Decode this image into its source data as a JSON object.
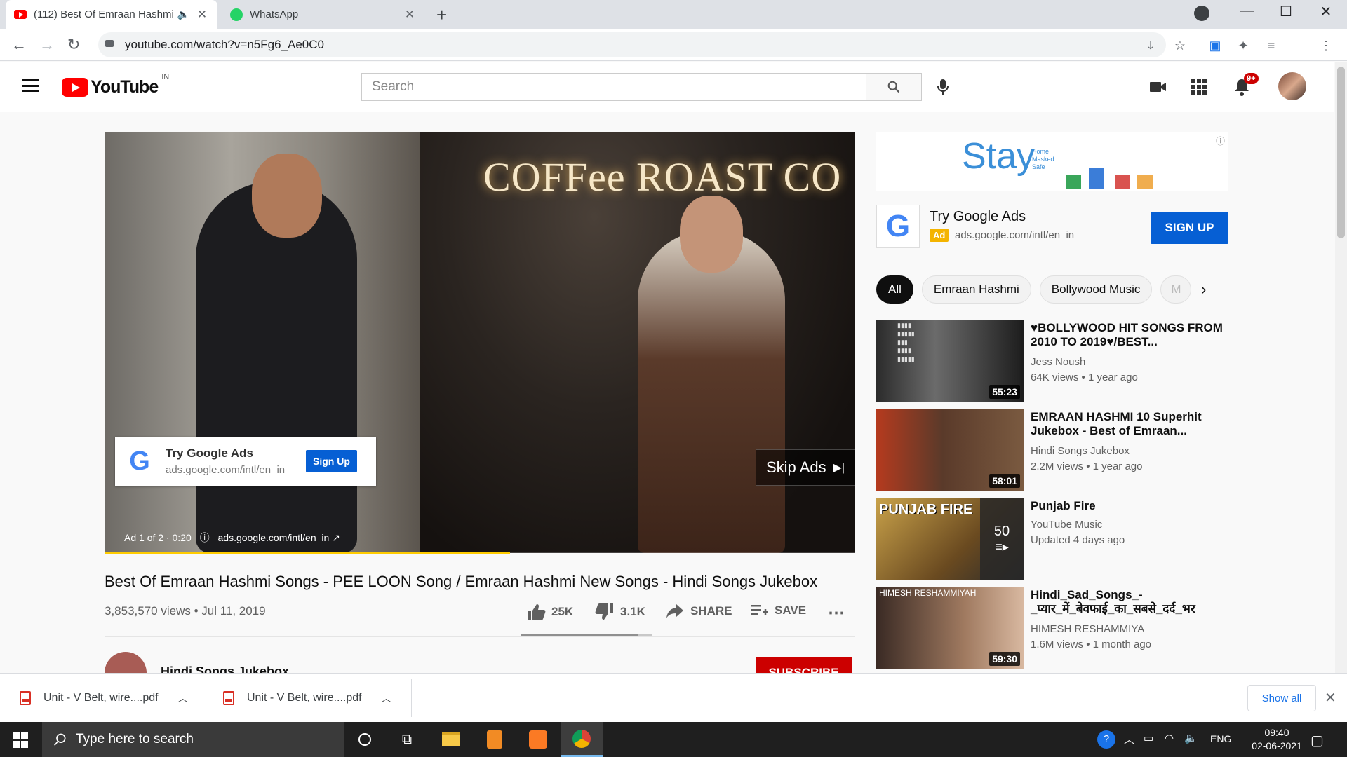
{
  "browser": {
    "tabs": [
      {
        "title": "(112) Best Of Emraan Hashmi",
        "favicon": "youtube-icon",
        "audio": true
      },
      {
        "title": "WhatsApp",
        "favicon": "whatsapp-icon"
      }
    ],
    "url": "youtube.com/watch?v=n5Fg6_Ae0C0"
  },
  "youtube": {
    "logo_text": "YouTube",
    "country_code": "IN",
    "search_placeholder": "Search",
    "notification_count": "9+"
  },
  "player": {
    "ad_overlay": {
      "title": "Try Google Ads",
      "url": "ads.google.com/intl/en_in",
      "button": "Sign Up"
    },
    "skip_label": "Skip Ads",
    "ad_info": "Ad 1 of 2 · 0:20",
    "ad_info_url": "ads.google.com/intl/en_in",
    "scene_sign": "COFFee ROAST CO",
    "ad_progress": 0.54
  },
  "video": {
    "title": "Best Of Emraan Hashmi Songs - PEE LOON Song / Emraan Hashmi New Songs - Hindi Songs Jukebox",
    "stats": "3,853,570 views • Jul 11, 2019",
    "likes": "25K",
    "dislikes": "3.1K",
    "share_label": "SHARE",
    "save_label": "SAVE",
    "like_ratio": 0.89,
    "channel_name": "Hindi Songs Jukebox",
    "subscribe_label": "SUBSCRIBE"
  },
  "sidebar": {
    "banner_text": "Stay",
    "banner_sub": [
      "Home",
      "Masked",
      "Safe"
    ],
    "promo": {
      "title": "Try Google Ads",
      "badge": "Ad",
      "url": "ads.google.com/intl/en_in",
      "button": "SIGN UP"
    },
    "chips": [
      "All",
      "Emraan Hashmi",
      "Bollywood Music",
      "M"
    ],
    "recommendations": [
      {
        "title": "♥BOLLYWOOD HIT SONGS FROM 2010 TO 2019♥/BEST...",
        "channel": "Jess Noush",
        "meta": "64K views • 1 year ago",
        "duration": "55:23"
      },
      {
        "title": "EMRAAN HASHMI 10 Superhit Jukebox - Best of Emraan...",
        "channel": "Hindi Songs Jukebox",
        "meta": "2.2M views • 1 year ago",
        "duration": "58:01"
      },
      {
        "title": "Punjab Fire",
        "channel": "YouTube Music",
        "meta": "Updated 4 days ago",
        "playlist_count": "50",
        "thumb_text": "PUNJAB FIRE"
      },
      {
        "title": "Hindi_Sad_Songs_-_प्यार_में_बेवफाई_का_सबसे_दर्द_भर",
        "channel": "HIMESH RESHAMMIYA",
        "meta": "1.6M views • 1 month ago",
        "duration": "59:30",
        "thumb_text": "HIMESH RESHAMMIYAH"
      }
    ]
  },
  "downloads": {
    "items": [
      "Unit - V Belt,  wire....pdf",
      "Unit - V Belt,  wire....pdf"
    ],
    "show_all": "Show all"
  },
  "taskbar": {
    "search_placeholder": "Type here to search",
    "language": "ENG",
    "time": "09:40",
    "date": "02-06-2021"
  },
  "colors": {
    "youtube_red": "#ff0000",
    "link_blue": "#065fd4",
    "ad_yellow": "#ffcc00"
  }
}
